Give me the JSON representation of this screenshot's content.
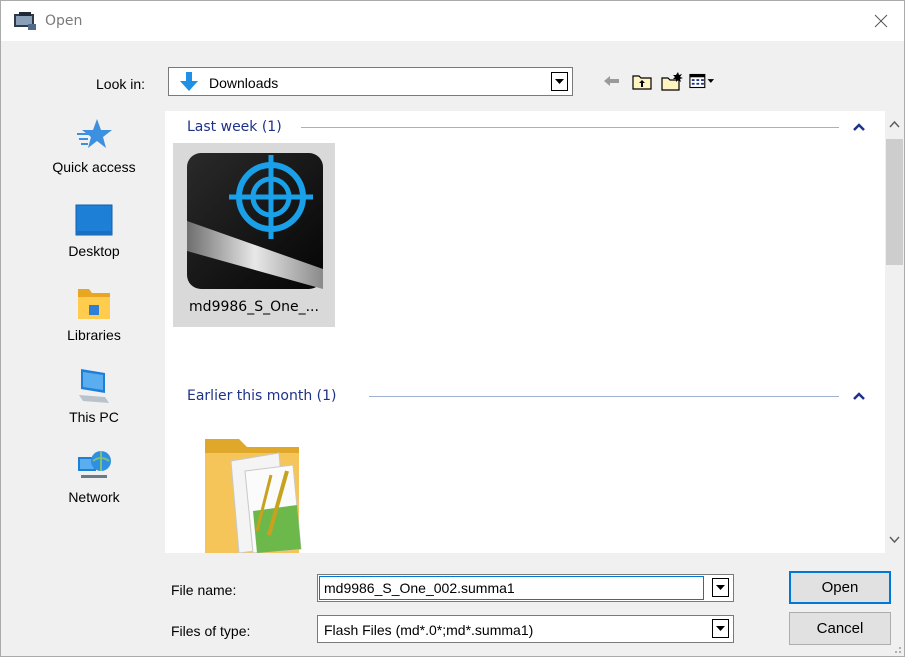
{
  "window": {
    "title": "Open",
    "close_glyph": "✕"
  },
  "lookin": {
    "label": "Look in:",
    "value": "Downloads",
    "icon": "download-arrow-icon"
  },
  "toolbar": {
    "buttons": [
      "back-arrow-icon",
      "up-folder-icon",
      "new-folder-icon",
      "view-menu-icon"
    ]
  },
  "places": [
    {
      "label": "Quick access",
      "icon": "star-icon"
    },
    {
      "label": "Desktop",
      "icon": "desktop-icon"
    },
    {
      "label": "Libraries",
      "icon": "libraries-icon"
    },
    {
      "label": "This PC",
      "icon": "computer-icon"
    },
    {
      "label": "Network",
      "icon": "network-icon"
    }
  ],
  "groups": [
    {
      "header": "Last week (1)",
      "files": [
        {
          "name": "md9986_S_One_...",
          "icon": "crosshair-app-icon",
          "selected": true
        }
      ]
    },
    {
      "header": "Earlier this month (1)",
      "files": [
        {
          "name": "",
          "icon": "folder-pictures-icon",
          "selected": false
        }
      ]
    }
  ],
  "file_name": {
    "label": "File name:",
    "value": "md9986_S_One_002.summa1"
  },
  "file_type": {
    "label": "Files of type:",
    "value": "Flash Files (md*.0*;md*.summa1)"
  },
  "buttons": {
    "open": "Open",
    "cancel": "Cancel"
  },
  "colors": {
    "group_header": "#1e3287",
    "selection": "#d9d9d9",
    "focus_border": "#0078d7",
    "accent_blue": "#1e90e6"
  }
}
